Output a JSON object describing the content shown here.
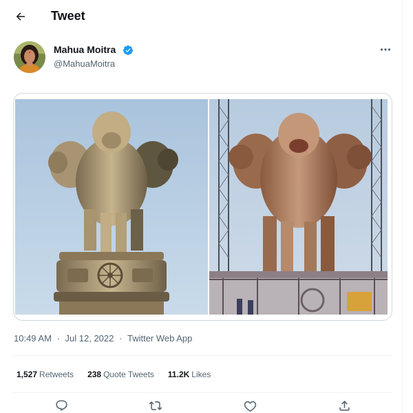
{
  "header": {
    "title": "Tweet",
    "back_icon": "arrow-left-icon"
  },
  "tweet": {
    "author": {
      "name": "Mahua Moitra",
      "handle": "@MahuaMoitra",
      "verified": true,
      "verified_color": "#1d9bf0"
    },
    "media": [
      {
        "description_icon": "photo-icon"
      },
      {
        "description_icon": "photo-icon"
      }
    ],
    "time": "10:49 AM",
    "separator": "·",
    "date": "Jul 12, 2022",
    "source": "Twitter Web App"
  },
  "stats": {
    "retweets": {
      "count": "1,527",
      "label": "Retweets"
    },
    "quote_tweets": {
      "count": "238",
      "label": "Quote Tweets"
    },
    "likes": {
      "count": "11.2K",
      "label": "Likes"
    }
  },
  "actions": {
    "reply_icon": "reply-icon",
    "retweet_icon": "retweet-icon",
    "like_icon": "heart-icon",
    "share_icon": "share-icon"
  },
  "colors": {
    "accent": "#1d9bf0",
    "text_primary": "#0f1419",
    "text_secondary": "#536471",
    "border": "#cfd9de"
  }
}
